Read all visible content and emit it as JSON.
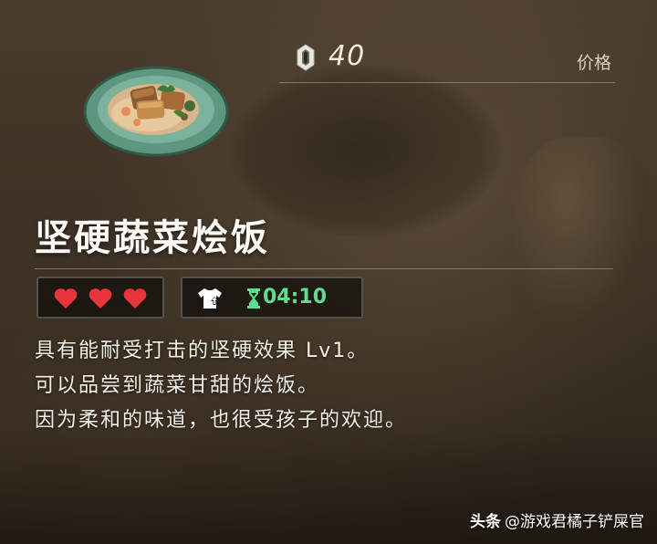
{
  "price": {
    "value": "40",
    "label": "价格",
    "icon": "rupee-icon"
  },
  "item": {
    "name": "坚硬蔬菜烩饭",
    "image": "dish-icon"
  },
  "stats": {
    "hearts": 3,
    "heart_icon": "heart-icon",
    "heart_color": "#e8343a",
    "effect_icon": "defense-up-tunic-icon",
    "timer_icon": "hourglass-icon",
    "duration": "04:10",
    "duration_color": "#5fdc8e"
  },
  "description": [
    "具有能耐受打击的坚硬效果 Lv1。",
    "可以品尝到蔬菜甘甜的烩饭。",
    "因为柔和的味道，也很受孩子的欢迎。"
  ],
  "watermark": {
    "brand": "头条",
    "handle": "@游戏君橘子铲屎官"
  }
}
